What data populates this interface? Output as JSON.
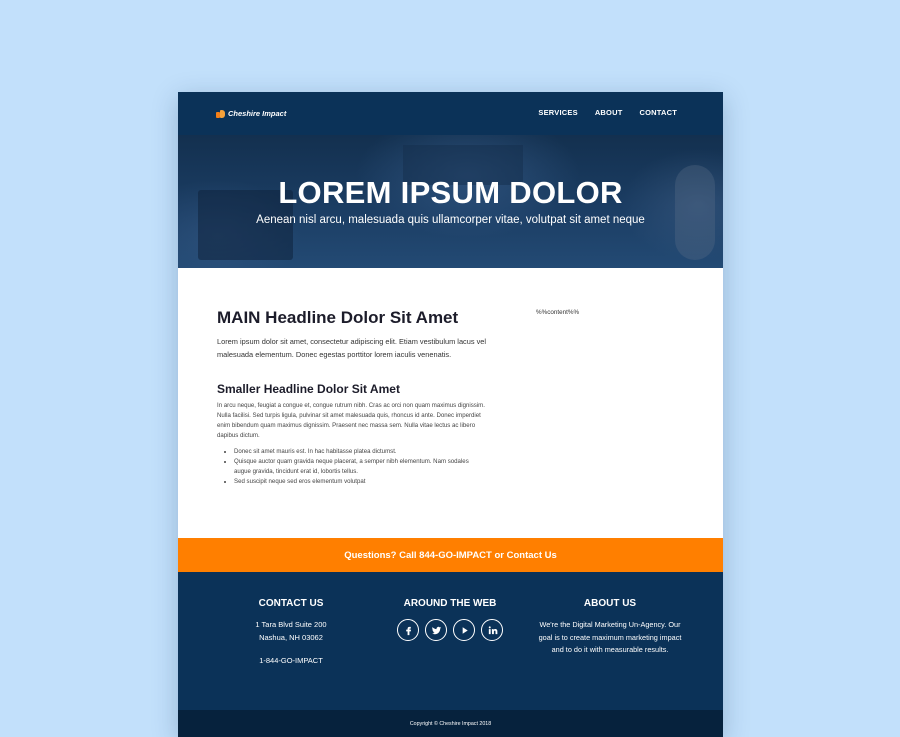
{
  "header": {
    "logo_text": "Cheshire Impact",
    "nav": [
      {
        "label": "SERVICES"
      },
      {
        "label": "ABOUT"
      },
      {
        "label": "CONTACT"
      }
    ]
  },
  "hero": {
    "title": "LOREM IPSUM DOLOR",
    "subtitle": "Aenean nisl arcu, malesuada quis ullamcorper vitae, volutpat sit amet neque"
  },
  "main": {
    "headline": "MAIN Headline Dolor Sit Amet",
    "intro": "Lorem ipsum dolor sit amet, consectetur adipiscing elit. Etiam vestibulum lacus vel malesuada elementum. Donec egestas porttitor lorem iaculis venenatis.",
    "sub_headline": "Smaller Headline Dolor Sit Amet",
    "body": "In arcu neque, feugiat a congue et, congue rutrum nibh. Cras ac orci non quam maximus dignissim. Nulla facilisi. Sed turpis ligula, pulvinar sit amet malesuada quis, rhoncus id ante. Donec imperdiet enim bibendum quam maximus dignissim. Praesent nec massa sem. Nulla vitae lectus ac libero dapibus dictum.",
    "bullets": [
      "Donec sit amet mauris est. In hac habitasse platea dictumst.",
      "Quisque auctor quam gravida neque placerat, a semper nibh elementum. Nam sodales augue gravida, tincidunt erat id, lobortis tellus.",
      "Sed suscipit neque sed eros elementum volutpat"
    ],
    "sidebar_placeholder": "%%content%%"
  },
  "cta": {
    "text": "Questions? Call 844-GO-IMPACT or Contact Us"
  },
  "footer": {
    "contact": {
      "heading": "CONTACT US",
      "address_line1": "1 Tara Blvd Suite 200",
      "address_line2": "Nashua, NH 03062",
      "phone": "1-844-GO-IMPACT"
    },
    "social": {
      "heading": "AROUND THE WEB",
      "icons": [
        "facebook-icon",
        "twitter-icon",
        "youtube-icon",
        "linkedin-icon"
      ]
    },
    "about": {
      "heading": "ABOUT US",
      "text": "We're the Digital Marketing Un-Agency. Our goal is to create maximum marketing impact and to do it with measurable results."
    },
    "copyright": "Copyright © Cheshire Impact 2018"
  },
  "colors": {
    "navy": "#0b3258",
    "orange": "#ff7f00",
    "background": "#c2e0fb"
  }
}
